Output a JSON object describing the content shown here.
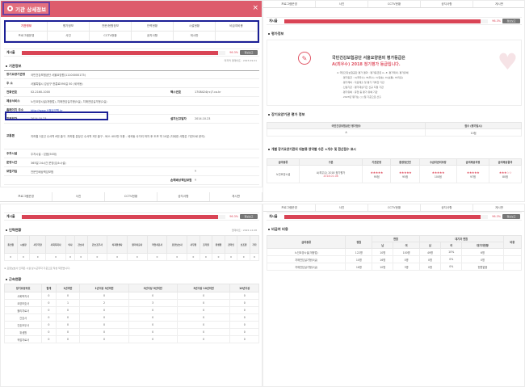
{
  "header": {
    "title": "기관 상세정보",
    "close": "×"
  },
  "tabs": {
    "row1": [
      "기관정보",
      "평가정보",
      "전문/현원정보",
      "인력현황",
      "시설현황",
      "비급여비용"
    ],
    "row2": [
      "프로그램운영",
      "사진",
      "CCTV현황",
      "공지사항",
      "게시판",
      ""
    ],
    "active": "기관정보"
  },
  "tabs_short": [
    "프로그램운영",
    "사진",
    "CCTV현황",
    "공지사항",
    "게시판"
  ],
  "bar": {
    "label": "게시율",
    "pct": "96.3%",
    "fill": 0.963,
    "button": "정보보고",
    "note": "마지막 업데이트 : 2023.09.01",
    "note2": "업데이트 : 2022.12.08"
  },
  "basic": {
    "title": "기관정보",
    "rows": [
      {
        "k": "장기요양기관명",
        "v": "국민건강보험공단 서울요양원(11100000175)"
      },
      {
        "k": "주 소",
        "v": "서울특별시 강남구 헌릉로590길 50 (세곡동)"
      },
      {
        "k": "전화번호",
        "v": "02-2160-1000",
        "k2": "팩스번호",
        "v2": "1708424(rc)7.co.kr"
      },
      {
        "k": "제공서비스",
        "v": "노인요양시설(개정법), 치매전담실가형(5실), 치매전담실가형(2실)"
      },
      {
        "k": "홈페이지 주소",
        "v": "http://www.서울요양원.kr"
      },
      {
        "k": "지정일자",
        "v": "2014.10.23",
        "k2": "설치신고일자",
        "v2": "2014.10.23"
      },
      {
        "k": "교통편",
        "v": "지하철 3호선 수서역 6번 출구, 지하철 분당선 수서역 3번 출구 - 버스 401번 이용 - 세곡동 사거리 하차 후 도보 약 10분 (자세한 사항은 기관으로 문의)"
      },
      {
        "k": "주차시설",
        "v": "주차시설 : 있음(50대)"
      },
      {
        "k": "운영시간",
        "v": "365일 24시간 운영(입소시설)"
      },
      {
        "k": "보험가입",
        "v": "전문인배상책임보험",
        "k2": "",
        "v2": "Y"
      },
      {
        "k": "",
        "v": "",
        "k2": "손해배상책임보험",
        "v2": "Y"
      }
    ]
  },
  "evaluation": {
    "title": "평가정보",
    "headline_a": "국민건강보험공단 서울요양원의 평가등급은",
    "headline_b": "A(최우수) 2018 정기평가 등급입니다.",
    "lines": [
      "※ 국민건강보험공단 평가 결과 : 평가등급은 A~E, 평가제외, 평가유예",
      "· 평가등급 : A(최우수), B(우수), C(양호), D(보통), E(미흡)",
      "· 평가제외 : 자료제출 및 평가 거부한 기관",
      "· 신설기관 : 평가대상기간 신규 지정 기관",
      "· 평가유예 : 휴업 등 평가 유예 기관",
      "· 2023년 평가는 ○○일 기준으로 산출"
    ],
    "sub": "장기요양기관 평가 정보",
    "table_headers": [
      "국민건강보험공단 평가점수",
      "점수 (평가일시)"
    ],
    "table_row": [
      "A",
      "10점"
    ],
    "evalgrade_title": "개별 장기요양기관의 대분류 영역별 수준 ★개수 및 환산점수 표시",
    "eval_headers": [
      "급여종류",
      "구분",
      "기관운영",
      "환경및안전",
      "수급자권리보장",
      "급여제공과정",
      "급여제공결과"
    ],
    "eval_row": {
      "kind": "노인요양시설",
      "grade": "A(최우수) 2018 정기평가",
      "date": "2018.01.08",
      "stars": [
        "★★★★★",
        "★★★★★",
        "★★★★★",
        "★★★★★",
        "★★★☆☆"
      ],
      "scores": [
        "95점",
        "95점",
        "100점",
        "97점",
        "80점"
      ]
    }
  },
  "staff": {
    "title": "인력현황",
    "headers": [
      "총인원",
      "시설장",
      "사무국장",
      "사회복지사",
      "의사",
      "간호사",
      "간호조무사",
      "치과위생사",
      "물리치료사",
      "작업치료사",
      "요양보호사",
      "사무원",
      "조리원",
      "위생원",
      "관리인",
      "보조원",
      "기타"
    ],
    "values": [
      "0",
      "0",
      "0",
      "0",
      "0",
      "0",
      "0",
      "0",
      "0",
      "0",
      "0",
      "0",
      "0",
      "0",
      "0",
      "0",
      "0"
    ],
    "legend": "※ 요양보호사 인력은 시설 상시근무자 기준으로 작성 되었습니다."
  },
  "tenure": {
    "title": "근속현황",
    "headers": [
      "장기요양보호",
      "합계",
      "1년미만",
      "1년이상 3년미만",
      "3년이상 5년미만",
      "5년이상 10년미만",
      "10년이상"
    ],
    "rows": [
      [
        "사회복지사",
        "0",
        "0",
        "0",
        "0",
        "0",
        "0"
      ],
      [
        "요양보호사",
        "0",
        "1",
        "2",
        "3",
        "0",
        "0"
      ],
      [
        "물리치료사",
        "0",
        "0",
        "0",
        "0",
        "0",
        "0"
      ],
      [
        "간호사",
        "0",
        "0",
        "0",
        "0",
        "0",
        "0"
      ],
      [
        "간호조무사",
        "0",
        "0",
        "0",
        "0",
        "0",
        "0"
      ],
      [
        "위생원",
        "0",
        "0",
        "0",
        "0",
        "0",
        "0"
      ],
      [
        "작업치료사",
        "0",
        "0",
        "0",
        "0",
        "0",
        "0"
      ]
    ]
  },
  "fees": {
    "title": "비급여 비용",
    "headers": [
      "급여종류",
      "정원",
      "남",
      "여",
      "남",
      "여",
      "대기자현황",
      "비용"
    ],
    "group_a": "현원",
    "group_b": "대기자 현원",
    "rows": [
      [
        "노인요양시설(개정법)",
        "122명",
        "10명",
        "100명",
        "49명",
        "10%",
        "6명"
      ],
      [
        "치매전담실가형(5실)",
        "10명",
        "16명",
        "0명",
        "0명",
        "0%",
        "0명"
      ],
      [
        "치매전담실가형(2실)",
        "16명",
        "10명",
        "3명",
        "0명",
        "0%",
        "현원없음"
      ]
    ]
  }
}
